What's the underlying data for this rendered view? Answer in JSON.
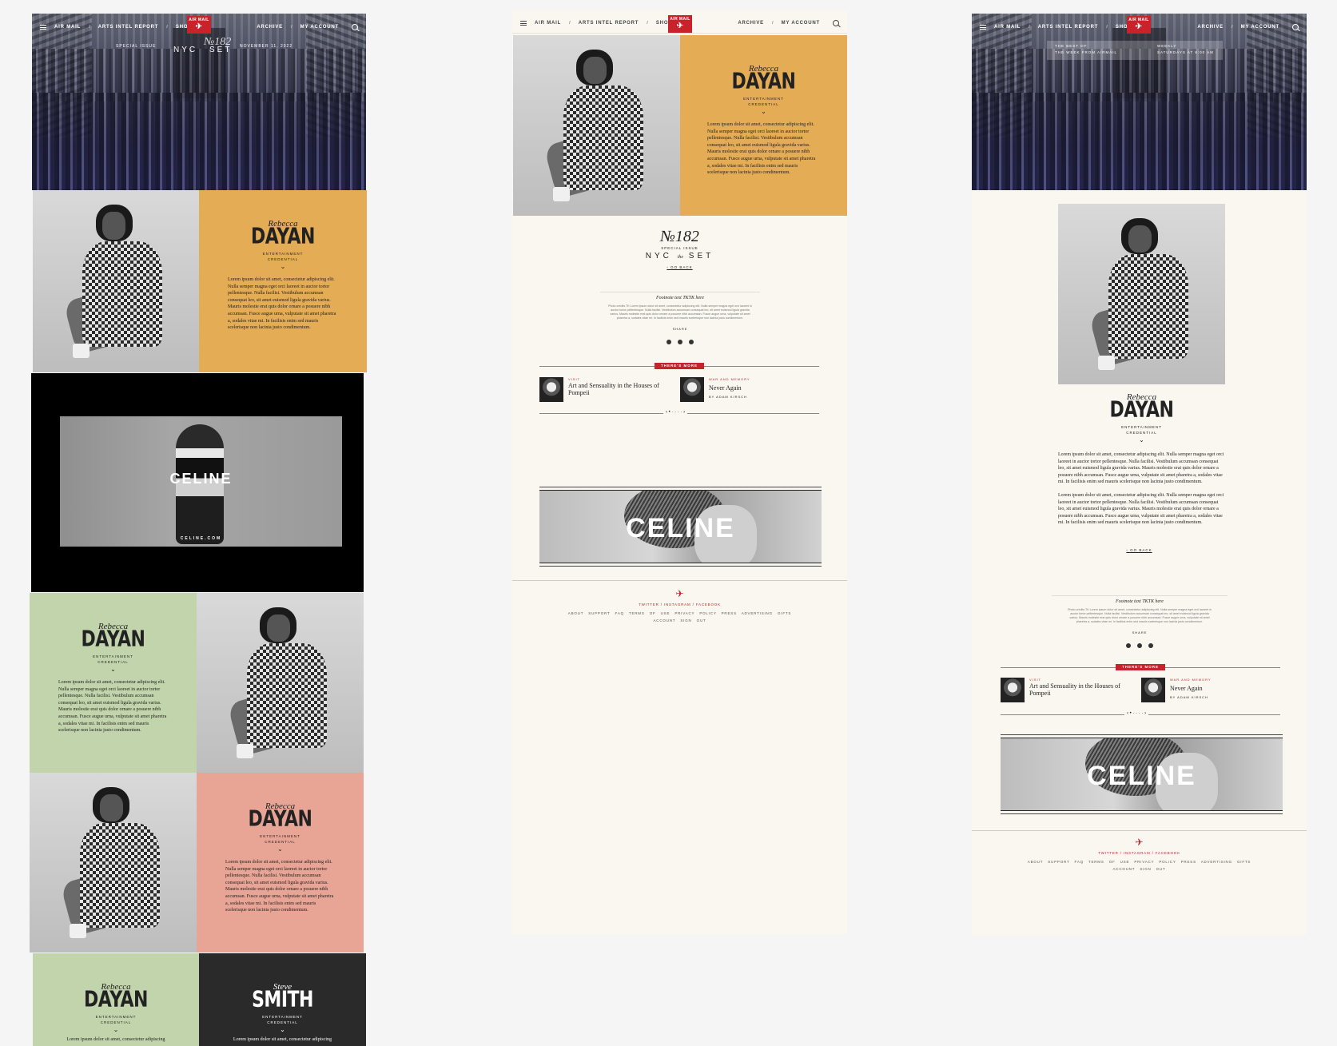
{
  "nav": {
    "items": [
      "AIR MAIL",
      "/",
      "ARTS INTEL REPORT",
      "/",
      "SHOP"
    ],
    "right": [
      "ARCHIVE",
      "/",
      "MY ACCOUNT"
    ],
    "logo": "AIR MAIL"
  },
  "hero_left": {
    "special_issue": "SPECIAL ISSUE",
    "date": "NOVEMBER 11, 2022",
    "issue_word": "NYC",
    "issue_word2": "SET",
    "number": "№182"
  },
  "hero_right": {
    "line1": "THE BEST OF",
    "line2": "THE WEEK FROM AIRMAIL",
    "line3": "WEEKLY",
    "line4": "SATURDAYS AT 6:00 AM"
  },
  "profiles": [
    {
      "first": "Rebecca",
      "last": "DAYAN",
      "cred1": "ENTERTAINMENT",
      "cred2": "CREDENTIAL",
      "chevron": "⌄"
    },
    {
      "first": "Steve",
      "last": "SMITH",
      "cred1": "ENTERTAINMENT",
      "cred2": "CREDENTIAL",
      "chevron": "⌄"
    }
  ],
  "lorem_short": "Lorem ipsum dolor sit amet, consectetur adipiscing elit. Nulla semper magna eget orci laoreet in auctor tortor pellentesque. Nulla facilisi. Vestibulum accumsan consequat leo, sit amet euismod ligula gravida varius. Mauris molestie erat quis dolor ornare a posuere nibh accumsan. Fusce augue urna, vulputate sit amet pharetra a, sodales vitae mi. In facilisis enim sed mauris scelerisque non lacinia justo condimentum.",
  "lorem_first_line": "Lorem ipsum dolor sit amet, consectetur adipiscing",
  "ad": {
    "brand": "CELINE",
    "url": "CELINE.COM"
  },
  "issue": {
    "number": "№182",
    "special": "SPECIAL ISSUE",
    "nyc": "NYC",
    "the": "the",
    "set": "SET",
    "go_back": "GO BACK"
  },
  "footnote": {
    "title": "Footnote text TKTK here",
    "body": "Photo credits TK Lorem ipsum dolor sit amet, consectetur adipiscing elit. Nulla semper magna eget orci laoreet in auctor tortor pellentesque. Nulla facilisi. Vestibulum accumsan consequat leo, sit amet euismod ligula gravida varius. Mauris molestie erat quis dolor ornare a posuere nibh accumsan. Fusce augue urna, vulputate sit amet pharetra a, sodales vitae mi. In facilisis enim sed mauris scelerisque non lacinia justo condimentum.",
    "share": "SHARE"
  },
  "more": {
    "ribbon": "THERE'S MORE",
    "items": [
      {
        "kicker": "VISIT",
        "title": "Art and Sensuality in the Houses of Pompeii",
        "byline": ""
      },
      {
        "kicker": "WAR AND MEMORY",
        "title": "Never Again",
        "byline": "BY ADAM KIRSCH"
      }
    ]
  },
  "footer": {
    "social": [
      "TWITTER",
      "/",
      "INSTAGRAM",
      "/",
      "FACEBOOK"
    ],
    "links1": [
      "ABOUT",
      "SUPPORT",
      "FAQ",
      "TERMS OF USE",
      "PRIVACY POLICY",
      "PRESS",
      "ADVERTISING",
      "GIFTS"
    ],
    "links2": [
      "ACCOUNT",
      "SIGN OUT"
    ]
  },
  "colors": {
    "orange": "#e4ac55",
    "green": "#c2d4ab",
    "pink": "#e8a596",
    "dark": "#2a2a2a",
    "red": "#c8222b",
    "cream": "#faf7f0"
  }
}
